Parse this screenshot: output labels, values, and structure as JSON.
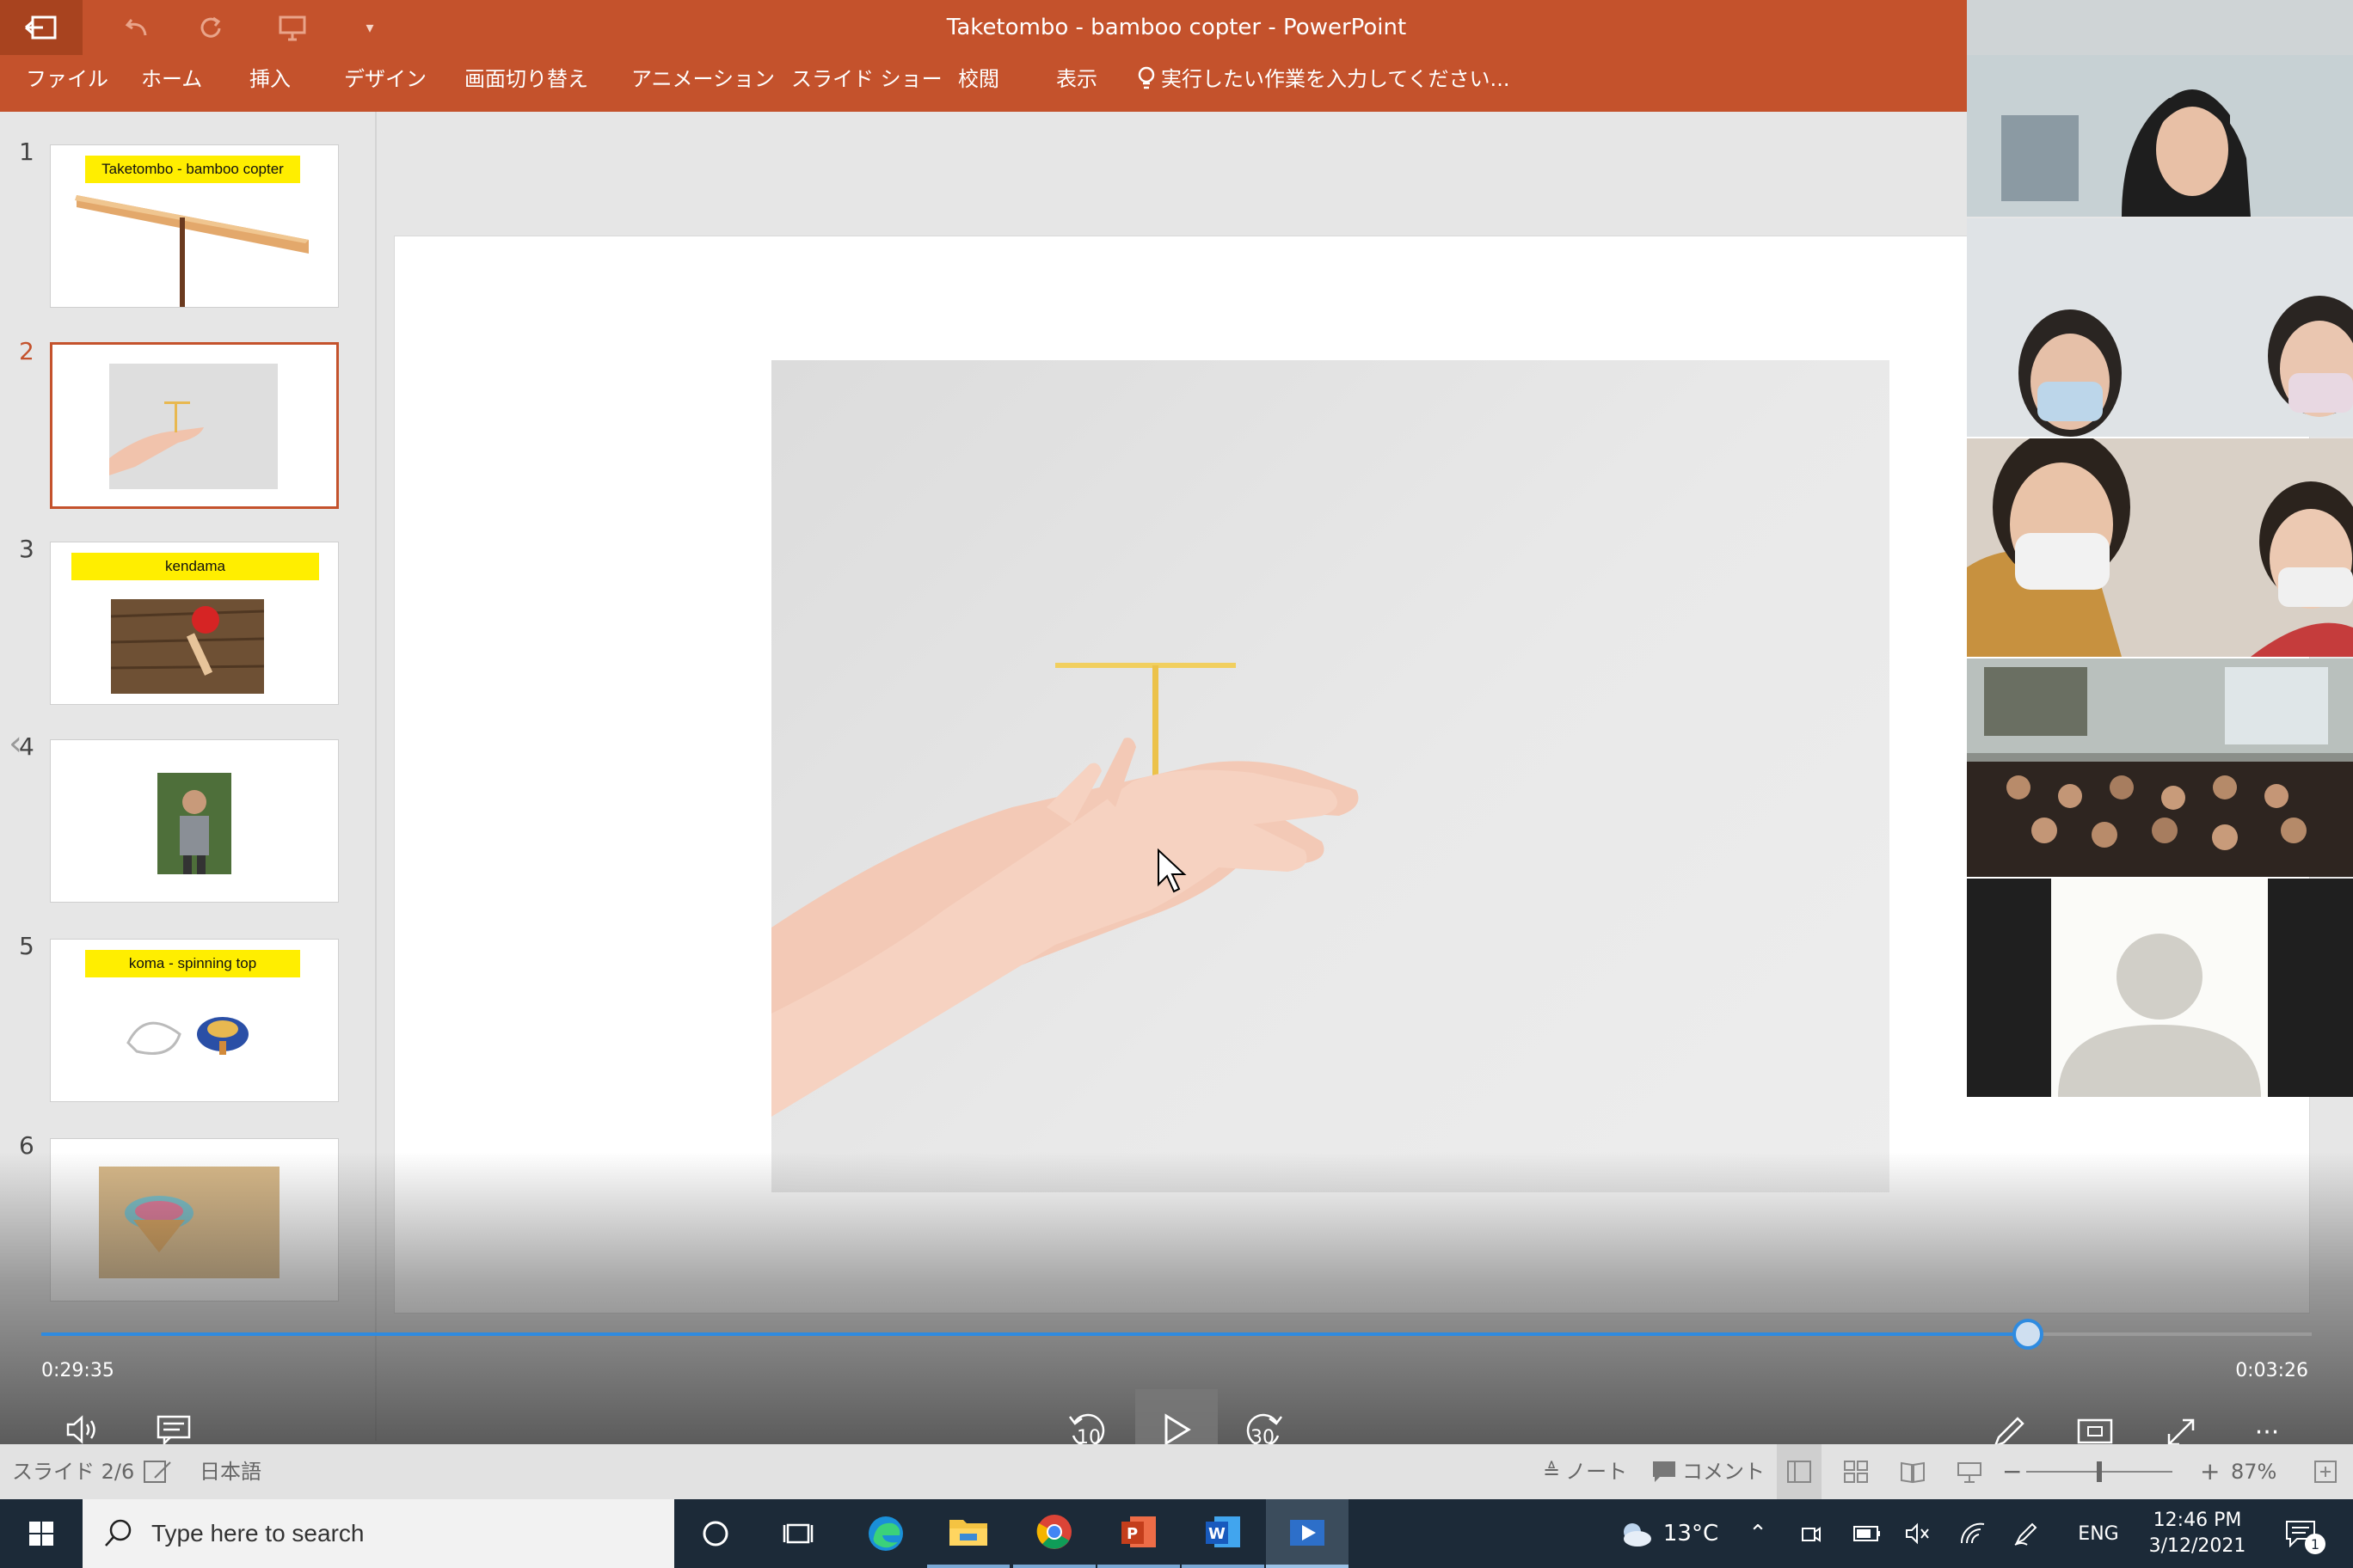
{
  "window": {
    "title": "Taketombo  - bamboo copter - PowerPoint",
    "menu": [
      "ファイル",
      "ホーム",
      "挿入",
      "デザイン",
      "画面切り替え",
      "アニメーション",
      "スライド ショー",
      "校閲",
      "表示"
    ],
    "tell_me": "実行したい作業を入力してください..."
  },
  "thumbnails": [
    {
      "num": "1",
      "title": "Taketombo  - bamboo copter"
    },
    {
      "num": "2",
      "title": ""
    },
    {
      "num": "3",
      "title": "kendama"
    },
    {
      "num": "4",
      "title": ""
    },
    {
      "num": "5",
      "title": "koma - spinning top"
    },
    {
      "num": "6",
      "title": ""
    }
  ],
  "media": {
    "elapsed": "0:29:35",
    "remaining": "0:03:26",
    "progress": 0.875,
    "rewind_label": "10",
    "forward_label": "30"
  },
  "status": {
    "slide": "スライド 2/6",
    "language": "日本語",
    "notes": "ノート",
    "comments": "コメント",
    "zoom": "87%"
  },
  "taskbar": {
    "search_placeholder": "Type here to search",
    "weather": "13°C",
    "lang": "ENG",
    "time": "12:46 PM",
    "date": "3/12/2021",
    "notif_count": "1"
  },
  "colors": {
    "ppt_accent": "#c4522c",
    "progress": "#2f8be0",
    "taskbar": "#1c2a38"
  }
}
